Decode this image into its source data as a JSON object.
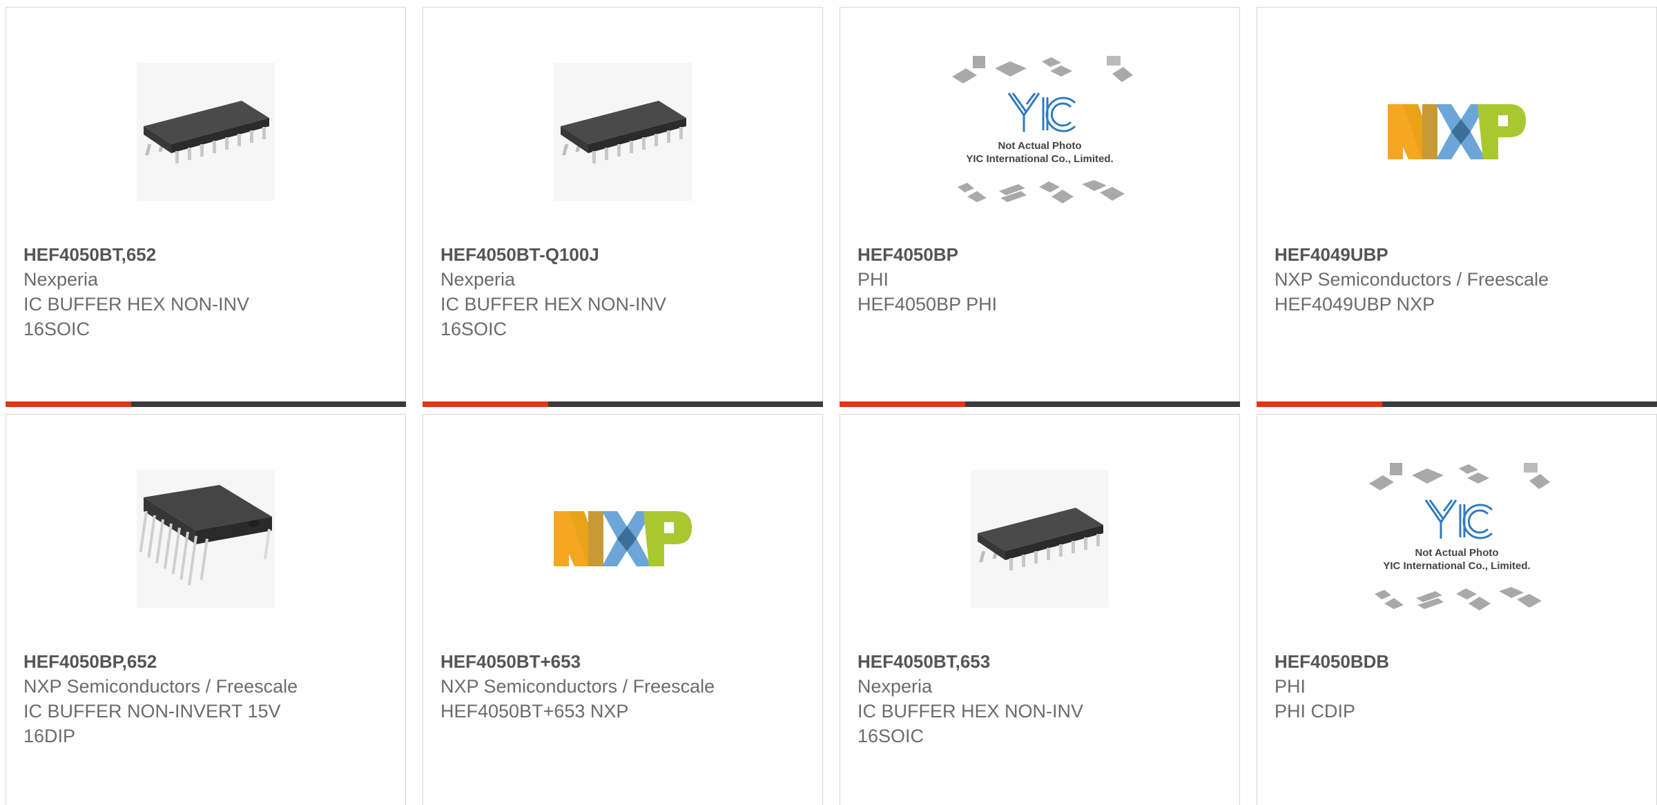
{
  "products": [
    {
      "part": "HEF4050BT,652",
      "manufacturer": "Nexperia",
      "desc1": "IC BUFFER HEX NON-INV",
      "desc2": "16SOIC",
      "image": "soic-chip"
    },
    {
      "part": "HEF4050BT-Q100J",
      "manufacturer": "Nexperia",
      "desc1": "IC BUFFER HEX NON-INV",
      "desc2": "16SOIC",
      "image": "soic-chip"
    },
    {
      "part": "HEF4050BP",
      "manufacturer": "PHI",
      "desc1": "HEF4050BP PHI",
      "desc2": "",
      "image": "placeholder",
      "placeholder_text1": "Not Actual Photo",
      "placeholder_text2": "YIC International Co., Limited.",
      "placeholder_logo": "YIC"
    },
    {
      "part": "HEF4049UBP",
      "manufacturer": "NXP Semiconductors / Freescale",
      "desc1": "HEF4049UBP NXP",
      "desc2": "",
      "image": "nxp-logo",
      "logo_text": "NXP"
    },
    {
      "part": "HEF4050BP,652",
      "manufacturer": "NXP Semiconductors / Freescale",
      "desc1": "IC BUFFER NON-INVERT 15V",
      "desc2": "16DIP",
      "image": "dip-chip"
    },
    {
      "part": "HEF4050BT+653",
      "manufacturer": "NXP Semiconductors / Freescale",
      "desc1": "HEF4050BT+653 NXP",
      "desc2": "",
      "image": "nxp-logo",
      "logo_text": "NXP"
    },
    {
      "part": "HEF4050BT,653",
      "manufacturer": "Nexperia",
      "desc1": "IC BUFFER HEX NON-INV",
      "desc2": "16SOIC",
      "image": "soic-chip"
    },
    {
      "part": "HEF4050BDB",
      "manufacturer": "PHI",
      "desc1": "PHI CDIP",
      "desc2": "",
      "image": "placeholder",
      "placeholder_text1": "Not Actual Photo",
      "placeholder_text2": "YIC International Co., Limited.",
      "placeholder_logo": "YIC"
    }
  ],
  "colors": {
    "accent": "#e63312",
    "bar": "#3b3b3b",
    "border": "#d6d6d6"
  }
}
